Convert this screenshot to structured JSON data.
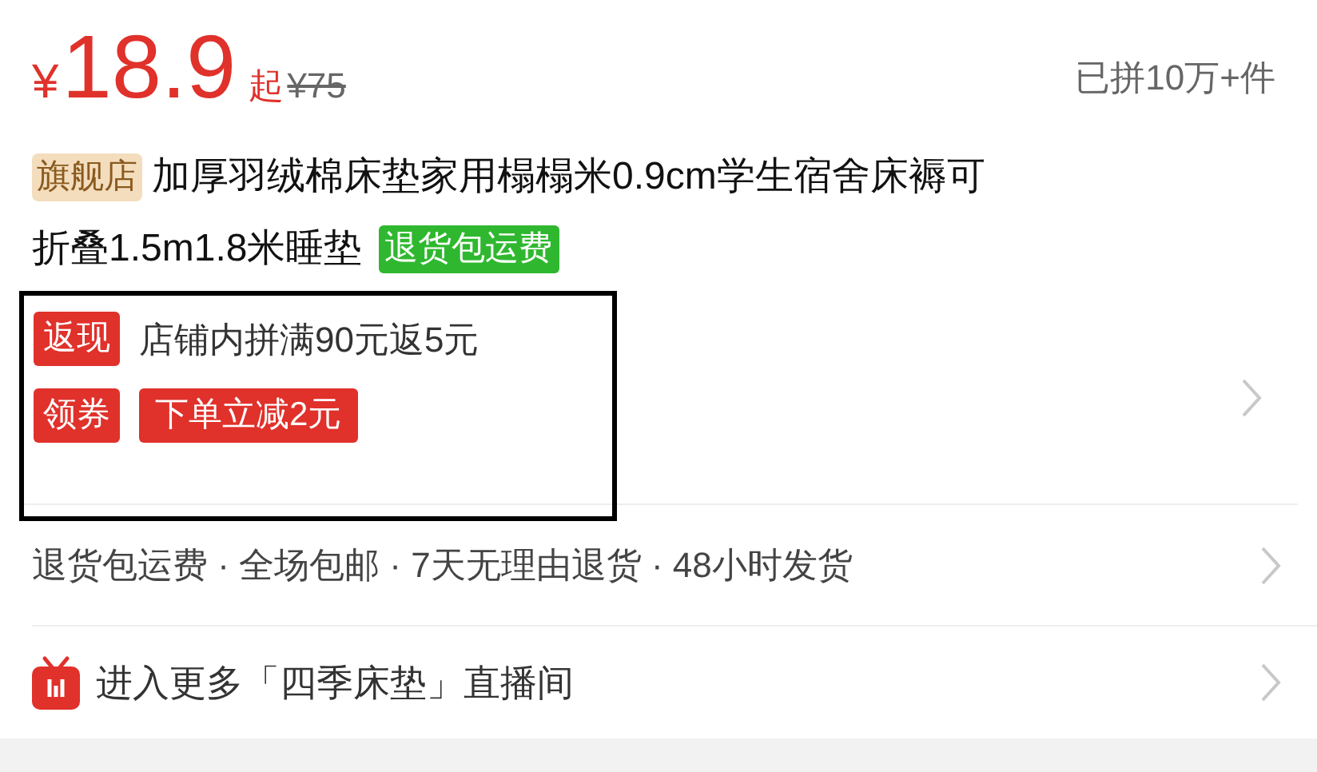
{
  "price": {
    "currency": "¥",
    "amount": "18.9",
    "suffix": "起",
    "original": "¥75",
    "sold": "已拼10万+件"
  },
  "title": {
    "badge": "旗舰店",
    "lines": [
      "加厚羽绒棉床垫家用榻榻米0.9cm学生宿舍床褥可",
      "折叠1.5m1.8米睡垫"
    ],
    "tag": "退货包运费"
  },
  "promotions": [
    {
      "label": "返现",
      "kind": "text",
      "text": "店铺内拼满90元返5元"
    },
    {
      "label": "领券",
      "kind": "coupon",
      "text": "下单立减2元"
    }
  ],
  "services": {
    "text": "退货包运费 · 全场包邮 · 7天无理由退货 · 48小时发货"
  },
  "live": {
    "text": "进入更多「四季床垫」直播间"
  }
}
